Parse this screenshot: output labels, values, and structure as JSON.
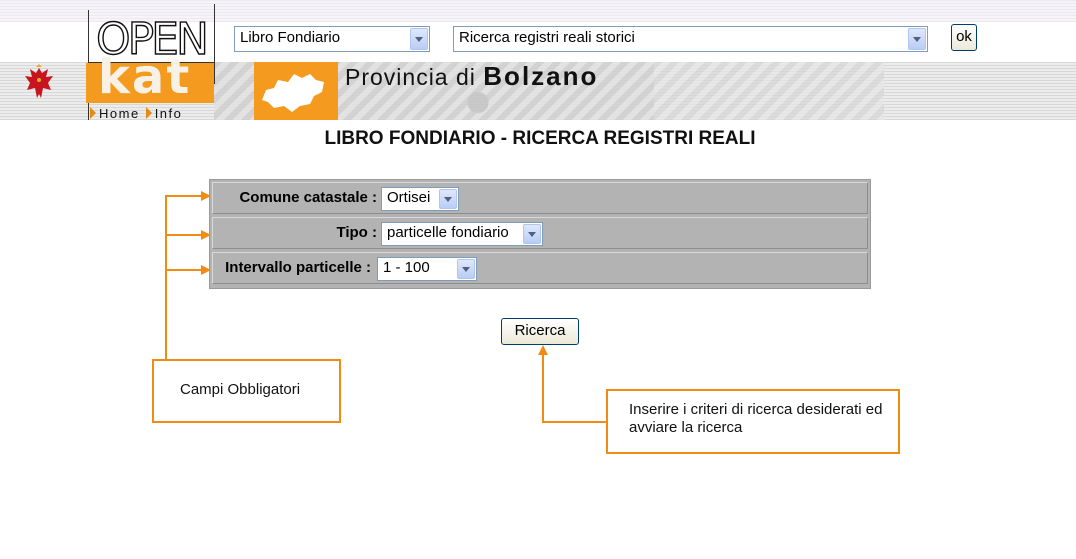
{
  "header": {
    "logo_top": "OPEN",
    "logo_bottom": "kat",
    "province_prefix": "Provincia di",
    "province_name": "Bolzano",
    "nav": [
      {
        "label": "Home"
      },
      {
        "label": "Info"
      }
    ],
    "register_select": {
      "value": "Libro Fondiario"
    },
    "search_select": {
      "value": "Ricerca registri reali storici"
    },
    "ok_label": "ok"
  },
  "page": {
    "title": "LIBRO FONDIARIO - RICERCA REGISTRI REALI"
  },
  "form": {
    "rows": [
      {
        "label": "Comune catastale :",
        "value": "Ortisei"
      },
      {
        "label": "Tipo :",
        "value": "particelle fondiario"
      },
      {
        "label": "Intervallo particelle :",
        "value": "1 - 100"
      }
    ],
    "submit_label": "Ricerca"
  },
  "annotations": {
    "required_fields": "Campi Obbligatori",
    "search_hint": "Inserire i criteri di ricerca desiderati ed avviare la ricerca"
  },
  "colors": {
    "brand_orange": "#f39a1f",
    "annotation_orange": "#f08c13",
    "form_background": "#b3b3b3"
  }
}
